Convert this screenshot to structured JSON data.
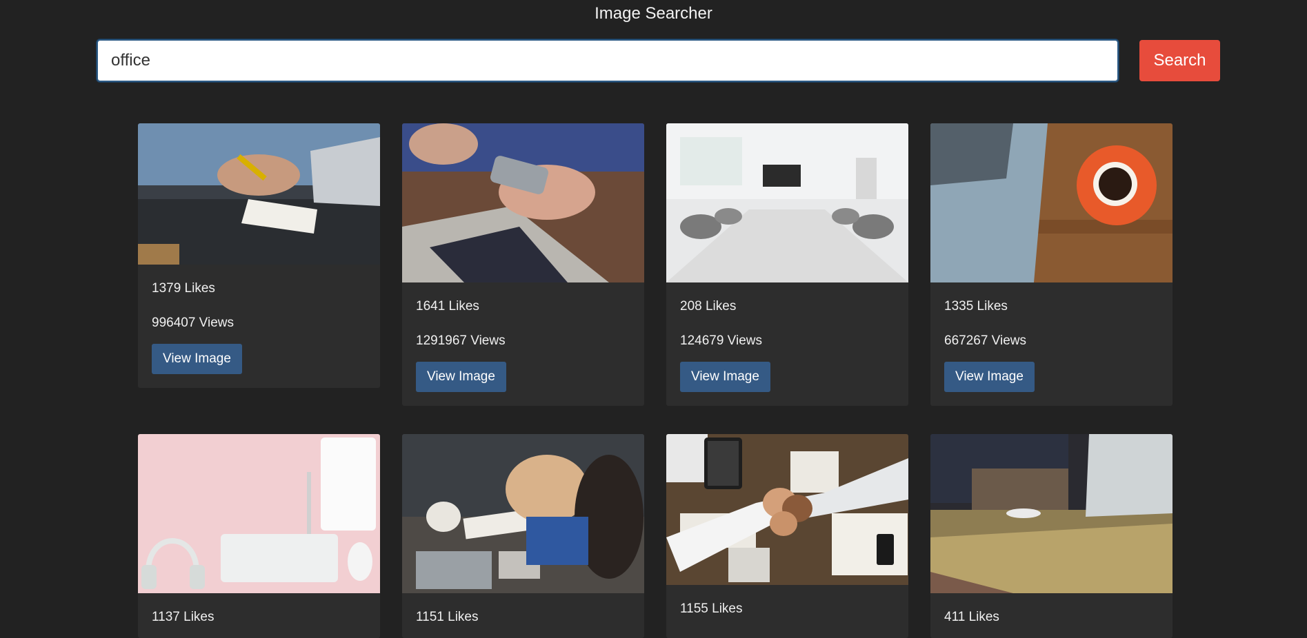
{
  "app": {
    "title": "Image Searcher"
  },
  "search": {
    "value": "office",
    "button_label": "Search"
  },
  "results": [
    {
      "likes": "1379 Likes",
      "views": "996407 Views",
      "button": "View Image",
      "image_icon": "person-writing-at-desk-photo"
    },
    {
      "likes": "1641 Likes",
      "views": "1291967 Views",
      "button": "View Image",
      "image_icon": "phone-and-laptop-photo"
    },
    {
      "likes": "208 Likes",
      "views": "124679 Views",
      "button": "View Image",
      "image_icon": "conference-room-photo"
    },
    {
      "likes": "1335 Likes",
      "views": "667267 Views",
      "button": "View Image",
      "image_icon": "laptop-and-coffee-photo"
    },
    {
      "likes": "1137 Likes",
      "image_icon": "desk-accessories-photo"
    },
    {
      "likes": "1151 Likes",
      "image_icon": "team-meeting-photo"
    },
    {
      "likes": "1155 Likes",
      "image_icon": "fist-bump-photo"
    },
    {
      "likes": "411 Likes",
      "image_icon": "laptop-on-table-photo"
    }
  ],
  "colors": {
    "background": "#222222",
    "card": "#2d2d2d",
    "search_button": "#e74c3c",
    "view_button": "#355a85"
  }
}
